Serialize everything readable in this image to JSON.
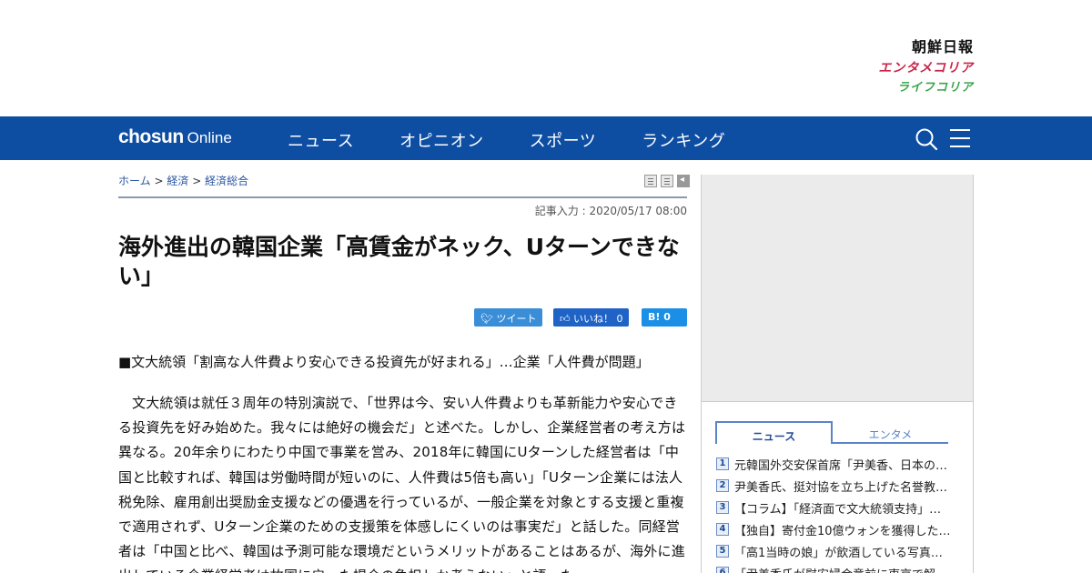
{
  "brands": {
    "chosun": "朝鮮日報",
    "entame": "エンタメコリア",
    "life": "ライフコリア"
  },
  "nav": {
    "logo_bold": "chosun",
    "logo_light": "Online",
    "items": [
      "ニュース",
      "オピニオン",
      "スポーツ",
      "ランキング"
    ],
    "search_icon": "search-icon",
    "menu_icon": "hamburger-menu-icon",
    "bg_color": "#0d4ea3"
  },
  "breadcrumb": {
    "home": "ホーム",
    "sep": ">",
    "level1": "経済",
    "level2": "経済総合"
  },
  "article": {
    "dateline": "記事入力 : 2020/05/17 08:00",
    "headline": "海外進出の韓国企業「高賃金がネック、Uターンできない」",
    "subhead": "■文大統領「割高な人件費より安心できる投資先が好まれる」…企業「人件費が問題」",
    "body": "文大統領は就任３周年の特別演説で、「世界は今、安い人件費よりも革新能力や安心できる投資先を好み始めた。我々には絶好の機会だ」と述べた。しかし、企業経営者の考え方は異なる。20年余りにわたり中国で事業を営み、2018年に韓国にUターンした経営者は「中国と比較すれば、韓国は労働時間が短いのに、人件費は5倍も高い」「Uターン企業には法人税免除、雇用創出奨励金支援などの優遇を行っているが、一般企業を対象とする支援と重複で適用されず、Uターン企業のための支援策を体感しにくいのは事実だ」と話した。同経営者は「中国と比べ、韓国は予測可能な環境だというメリットがあることはあるが、海外に進出している企業経営者は故国に戻った場合の負担しか考えない」と語った。"
  },
  "share": {
    "tweet": "ツイート",
    "like": "いいね！ 0",
    "hatena": "B! 0"
  },
  "sidebar": {
    "tabs": [
      "ニュース",
      "エンタメ"
    ],
    "ranking": [
      {
        "rank": "1",
        "title": "元韓国外交安保首席「尹美香、日本の慰安婦合意を…"
      },
      {
        "rank": "2",
        "title": "尹美香氏、挺対協を立ち上げた名誉教授に…"
      },
      {
        "rank": "3",
        "title": "【コラム】「経済面で文大統領支持」…"
      },
      {
        "rank": "4",
        "title": "【独自】寄付金10億ウォンを獲得した…"
      },
      {
        "rank": "5",
        "title": "「高1当時の娘」が飲酒している写真…"
      },
      {
        "rank": "6",
        "title": "「尹美香氏が慰安婦合意前に東京で解…"
      }
    ]
  }
}
